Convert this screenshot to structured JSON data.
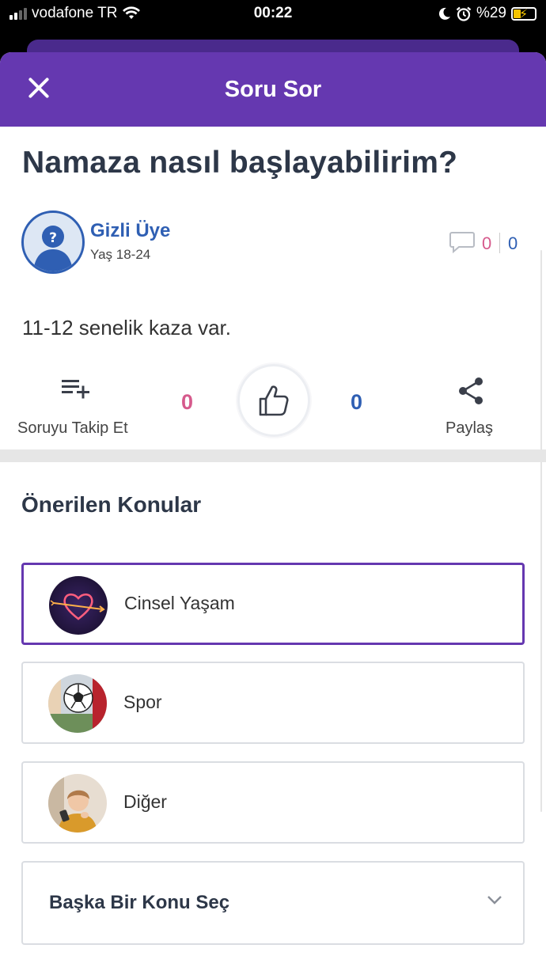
{
  "status_bar": {
    "carrier": "vodafone TR",
    "time": "00:22",
    "battery_percent": "%29",
    "icons": [
      "signal-icon",
      "wifi-icon",
      "moon-icon",
      "alarm-icon",
      "battery-charging-icon"
    ]
  },
  "header": {
    "title": "Soru Sor",
    "close_icon": "close-icon",
    "color": "#6538b0"
  },
  "question": {
    "title": "Namaza nasıl başlayabilirim?",
    "body": "11-12 senelik kaza var.",
    "author": {
      "name": "Gizli Üye",
      "age": "Yaş 18-24"
    },
    "comment_counts": {
      "pink": "0",
      "blue": "0"
    }
  },
  "actions": {
    "follow_label": "Soruyu Takip Et",
    "like_count_pink": "0",
    "like_count_blue": "0",
    "share_label": "Paylaş",
    "icons": [
      "playlist-add-icon",
      "thumbs-up-icon",
      "share-icon"
    ]
  },
  "suggested": {
    "title": "Önerilen Konular",
    "topics": [
      {
        "label": "Cinsel Yaşam",
        "selected": true,
        "image": "neon-heart-arrow"
      },
      {
        "label": "Spor",
        "selected": false,
        "image": "soccer-ball"
      },
      {
        "label": "Diğer",
        "selected": false,
        "image": "woman-with-phone"
      }
    ],
    "other_select": {
      "label": "Başka Bir Konu Seç"
    }
  },
  "colors": {
    "accent_purple": "#6538b0",
    "blue": "#2f5fb3",
    "pink": "#d65a8c",
    "text_dark": "#2d3748"
  }
}
